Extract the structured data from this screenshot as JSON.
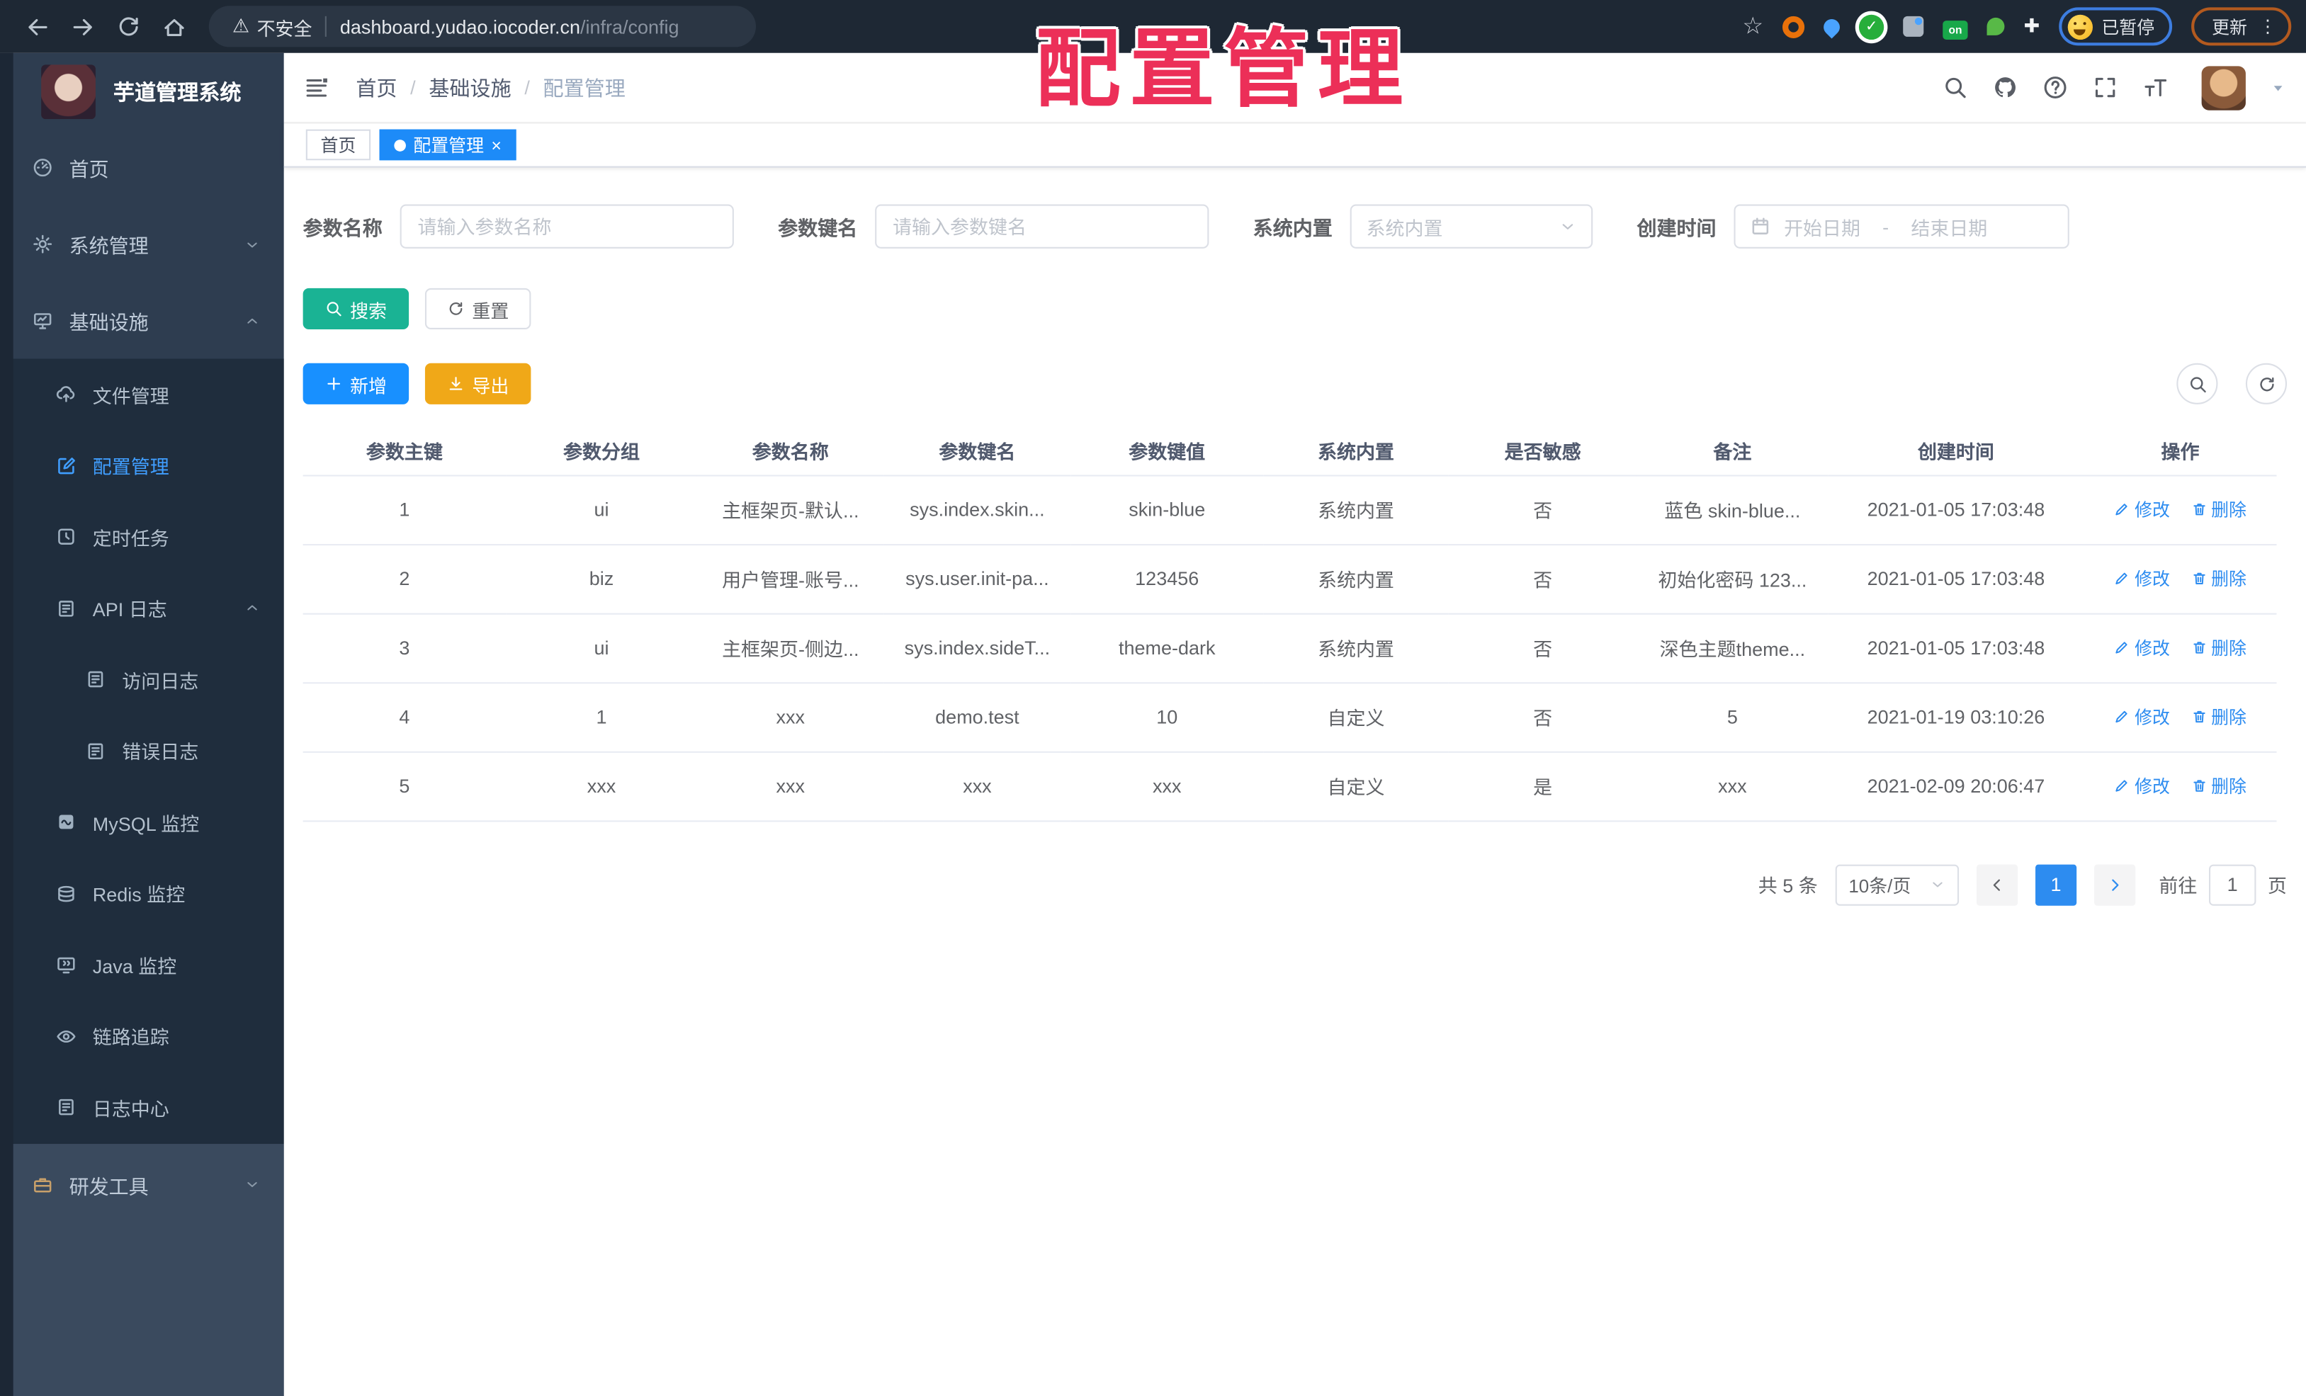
{
  "watermark_text": "配置管理",
  "colors": {
    "primary_blue": "#2d8cf0",
    "menu_active_blue": "#409eff",
    "search_teal": "#1ab394",
    "add_blue": "#1890ff",
    "export_orange": "#f0a818",
    "tag_active_blue": "#1d8bf8",
    "watermark_red": "#ec2f58"
  },
  "browser": {
    "security_label": "不安全",
    "url_host": "dashboard.yudao.iocoder.cn",
    "url_path": "/infra/config",
    "paused_badge_label": "已暂停",
    "update_button_label": "更新"
  },
  "sidebar": {
    "app_title": "芋道管理系统",
    "items": [
      {
        "label": "首页",
        "icon": "dashboard-icon",
        "level": 1,
        "section": "base"
      },
      {
        "label": "系统管理",
        "icon": "gear-icon",
        "level": 1,
        "section": "base",
        "chevron": "down"
      },
      {
        "label": "基础设施",
        "icon": "monitor-icon",
        "level": 1,
        "section": "base",
        "chevron": "up"
      },
      {
        "label": "文件管理",
        "icon": "cloud-upload-icon",
        "level": 2,
        "section": "sub"
      },
      {
        "label": "配置管理",
        "icon": "edit-square-icon",
        "level": 2,
        "section": "sub",
        "active": true
      },
      {
        "label": "定时任务",
        "icon": "timer-icon",
        "level": 2,
        "section": "sub"
      },
      {
        "label": "API 日志",
        "icon": "document-pen-icon",
        "level": 2,
        "section": "sub",
        "chevron": "up"
      },
      {
        "label": "访问日志",
        "icon": "document-pen-icon",
        "level": 3,
        "section": "sub"
      },
      {
        "label": "错误日志",
        "icon": "document-pen-icon",
        "level": 3,
        "section": "sub"
      },
      {
        "label": "MySQL 监控",
        "icon": "mysql-icon",
        "level": 2,
        "section": "sub"
      },
      {
        "label": "Redis 监控",
        "icon": "redis-icon",
        "level": 2,
        "section": "sub"
      },
      {
        "label": "Java 监控",
        "icon": "java-icon",
        "level": 2,
        "section": "sub"
      },
      {
        "label": "链路追踪",
        "icon": "eye-icon",
        "level": 2,
        "section": "sub"
      },
      {
        "label": "日志中心",
        "icon": "document-pen-icon",
        "level": 2,
        "section": "sub"
      },
      {
        "label": "研发工具",
        "icon": "briefcase-icon",
        "level": 1,
        "section": "bottom",
        "chevron": "down"
      }
    ]
  },
  "navbar": {
    "breadcrumb": [
      "首页",
      "基础设施",
      "配置管理"
    ],
    "icons": [
      "search-icon",
      "github-icon",
      "help-icon",
      "fullscreen-icon",
      "font-size-icon"
    ]
  },
  "tags": [
    {
      "label": "首页"
    },
    {
      "label": "配置管理"
    }
  ],
  "filters": {
    "name_label": "参数名称",
    "name_placeholder": "请输入参数名称",
    "key_label": "参数键名",
    "key_placeholder": "请输入参数键名",
    "type_label": "系统内置",
    "type_placeholder": "系统内置",
    "date_label": "创建时间",
    "date_start_placeholder": "开始日期",
    "date_separator": "-",
    "date_end_placeholder": "结束日期",
    "search_label": "搜索",
    "reset_label": "重置"
  },
  "toolbar": {
    "add_label": "新增",
    "export_label": "导出"
  },
  "table": {
    "headers": [
      "参数主键",
      "参数分组",
      "参数名称",
      "参数键名",
      "参数键值",
      "系统内置",
      "是否敏感",
      "备注",
      "创建时间",
      "操作"
    ],
    "edit_label": "修改",
    "delete_label": "删除",
    "rows": [
      {
        "cells": [
          "1",
          "ui",
          "主框架页-默认...",
          "sys.index.skin...",
          "skin-blue",
          "系统内置",
          "否",
          "蓝色 skin-blue...",
          "2021-01-05 17:03:48"
        ]
      },
      {
        "cells": [
          "2",
          "biz",
          "用户管理-账号...",
          "sys.user.init-pa...",
          "123456",
          "系统内置",
          "否",
          "初始化密码 123...",
          "2021-01-05 17:03:48"
        ]
      },
      {
        "cells": [
          "3",
          "ui",
          "主框架页-侧边...",
          "sys.index.sideT...",
          "theme-dark",
          "系统内置",
          "否",
          "深色主题theme...",
          "2021-01-05 17:03:48"
        ]
      },
      {
        "cells": [
          "4",
          "1",
          "xxx",
          "demo.test",
          "10",
          "自定义",
          "否",
          "5",
          "2021-01-19 03:10:26"
        ]
      },
      {
        "cells": [
          "5",
          "xxx",
          "xxx",
          "xxx",
          "xxx",
          "自定义",
          "是",
          "xxx",
          "2021-02-09 20:06:47"
        ]
      }
    ]
  },
  "pagination": {
    "total_text": "共 5 条",
    "page_size_text": "10条/页",
    "current_page": "1",
    "goto_label": "前往",
    "goto_value": "1",
    "page_unit": "页"
  }
}
